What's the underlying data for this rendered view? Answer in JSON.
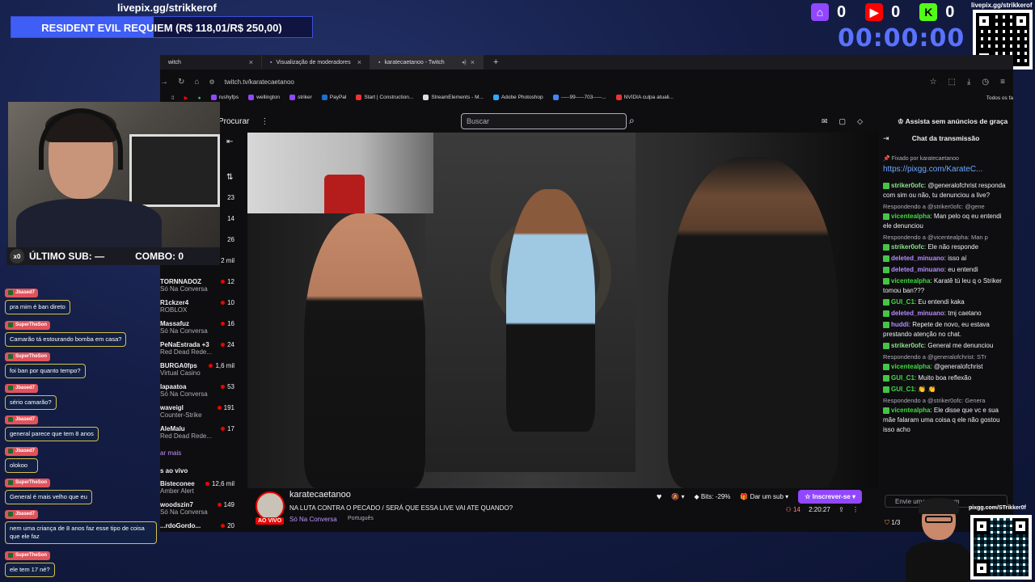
{
  "overlay": {
    "pix_url": "livepix.gg/strikkerof",
    "goal_text": "RESIDENT EVIL REQUIEM (R$ 118,01/R$ 250,00)",
    "goal_progress": 0.472,
    "platforms": [
      {
        "name": "twitch-icon",
        "count": "0",
        "color": "#9147ff"
      },
      {
        "name": "youtube-icon",
        "count": "0",
        "color": "#ff0000"
      },
      {
        "name": "kick-icon",
        "count": "0",
        "color": "#53fc18"
      }
    ],
    "qr_label": "livepix.gg/strikkerof",
    "timer": "00:00:00",
    "ultimo_sub": "ÚLTIMO SUB: —",
    "combo": "COMBO: 0",
    "combo_badge": "x0",
    "qr2_label": "pixgg.com/STrikker0f"
  },
  "browser": {
    "tabs": [
      {
        "label": "witch",
        "active": false
      },
      {
        "label": "Visualização de moderadores",
        "active": false
      },
      {
        "label": "karatecaetanoo - Twitch",
        "active": true
      }
    ],
    "address": "twitch.tv/karatecaetanoo",
    "bookmarks": [
      "rushyfps",
      "wellington",
      "striker",
      "PayPal",
      "Start | Construction...",
      "StreamElements - M...",
      "Adobe Photoshop",
      "-----99-----703-----...",
      "NVIDIA culpa atuali...",
      "Todos os fa"
    ]
  },
  "twitch": {
    "browse": "Procurar",
    "search_placeholder": "Buscar",
    "no_ads": "Assista sem anúncios de graça",
    "sidebar": [
      {
        "value": "23"
      },
      {
        "value": "14"
      },
      {
        "value": "26"
      },
      {
        "value": "2 mil"
      },
      {
        "name": "TORNNADOZ",
        "game": "Só Na Conversa",
        "value": "12"
      },
      {
        "name": "R1ckzer4",
        "game": "ROBLOX",
        "value": "10"
      },
      {
        "name": "Massafuz",
        "game": "Só Na Conversa",
        "value": "16"
      },
      {
        "name": "PeNaEstrada +3",
        "game": "Red Dead Rede...",
        "value": "24"
      },
      {
        "name": "BURGA0fps",
        "game": "Virtual Casino",
        "value": "1,6 mil"
      },
      {
        "name": "lapaatoa",
        "game": "Só Na Conversa",
        "value": "53"
      },
      {
        "name": "waveigl",
        "game": "Counter-Strike",
        "value": "191"
      },
      {
        "name": "AleMalu",
        "game": "Red Dead Rede...",
        "value": "17"
      },
      {
        "name": "Bisteconee",
        "game": "Amber Alert",
        "value": "12,6 mil"
      },
      {
        "name": "woodszin7",
        "game": "Só Na Conversa",
        "value": "149"
      },
      {
        "name": "...rdoGordo...",
        "game": "",
        "value": "20"
      }
    ],
    "show_more": "ar mais",
    "live_section": "s ao vivo",
    "stream": {
      "name": "karatecaetanoo",
      "title": "NA LUTA CONTRA O PECADO / SERÁ QUE ESSA LIVE VAI ATE QUANDO?",
      "category": "Só Na Conversa",
      "language": "Português",
      "live_tag": "AO VIVO",
      "bits": "Bits: -29%",
      "gift": "Dar um sub",
      "subscribe": "Inscrever-se",
      "viewers": "14",
      "uptime": "2:20:27"
    },
    "chat": {
      "title": "Chat da transmissão",
      "pinned_by": "Fixado por  karatecaetanoo",
      "pinned_link": "https://pixgg.com/KarateC...",
      "input_placeholder": "Envie uma mensagem",
      "points": "1/3",
      "messages": [
        {
          "user": "striker0ofc",
          "cls": "u-green",
          "text": ": @generalofchrist responda com sim ou não, tu denunciou a live?"
        },
        {
          "reply": "Respondendo a @striker0ofc: @gene",
          "user": "vicentealpha",
          "cls": "u-green2",
          "text": ": Man pelo oq eu entendi ele denunciou"
        },
        {
          "reply": "Respondendo a @vicentealpha: Man p",
          "user": "striker0ofc",
          "cls": "u-green",
          "text": ": Ele não responde"
        },
        {
          "user": "deleted_minuano",
          "cls": "u-purple",
          "text": ": isso aí"
        },
        {
          "user": "deleted_minuano",
          "cls": "u-purple",
          "text": ": eu entendi"
        },
        {
          "user": "vicentealpha",
          "cls": "u-green2",
          "text": ": Karatê tú leu q o Striker tomou ban???"
        },
        {
          "user": "GUI_C1",
          "cls": "u-green2",
          "text": ": Eu entendi kaka"
        },
        {
          "user": "deleted_minuano",
          "cls": "u-purple",
          "text": ": tmj caetano"
        },
        {
          "user": "huddi",
          "cls": "u-purple",
          "text": ": Repete de novo, eu estava prestando atenção no chat."
        },
        {
          "user": "striker0ofc",
          "cls": "u-green",
          "text": ": General me denunciou"
        },
        {
          "reply": "Respondendo a @generalofchrist: STr",
          "user": "vicentealpha",
          "cls": "u-green2",
          "text": ": @generalofchrist"
        },
        {
          "user": "GUI_C1",
          "cls": "u-green2",
          "text": ": Muito boa reflexão"
        },
        {
          "user": "GUI_C1",
          "cls": "u-green2",
          "text": ": 👏 👏"
        },
        {
          "reply": "Respondendo a @striker0ofc: Genera",
          "user": "vicentealpha",
          "cls": "u-green2",
          "text": ": Ele disse que vc e sua mãe falaram uma coisa q ele não gostou isso acho"
        }
      ]
    }
  },
  "overlay_chat": [
    {
      "user": "Jbased7",
      "text": "pra mim é ban direto"
    },
    {
      "user": "SuperTheSon",
      "text": "Camarão tá estourando bomba em casa?"
    },
    {
      "user": "SuperTheSon",
      "text": "foi ban por quanto tempo?"
    },
    {
      "user": "Jbased7",
      "text": "sério camarão?"
    },
    {
      "user": "Jbased7",
      "text": "general parece que tem 8 anos"
    },
    {
      "user": "Jbased7",
      "text": "olokoo"
    },
    {
      "user": "SuperTheSon",
      "text": "General é mais velho que eu"
    },
    {
      "user": "Jbased7",
      "text": "nem uma criança de 8 anos faz esse tipo de coisa que ele faz"
    },
    {
      "user": "SuperTheSon",
      "text": "ele tem 17 né?"
    }
  ]
}
